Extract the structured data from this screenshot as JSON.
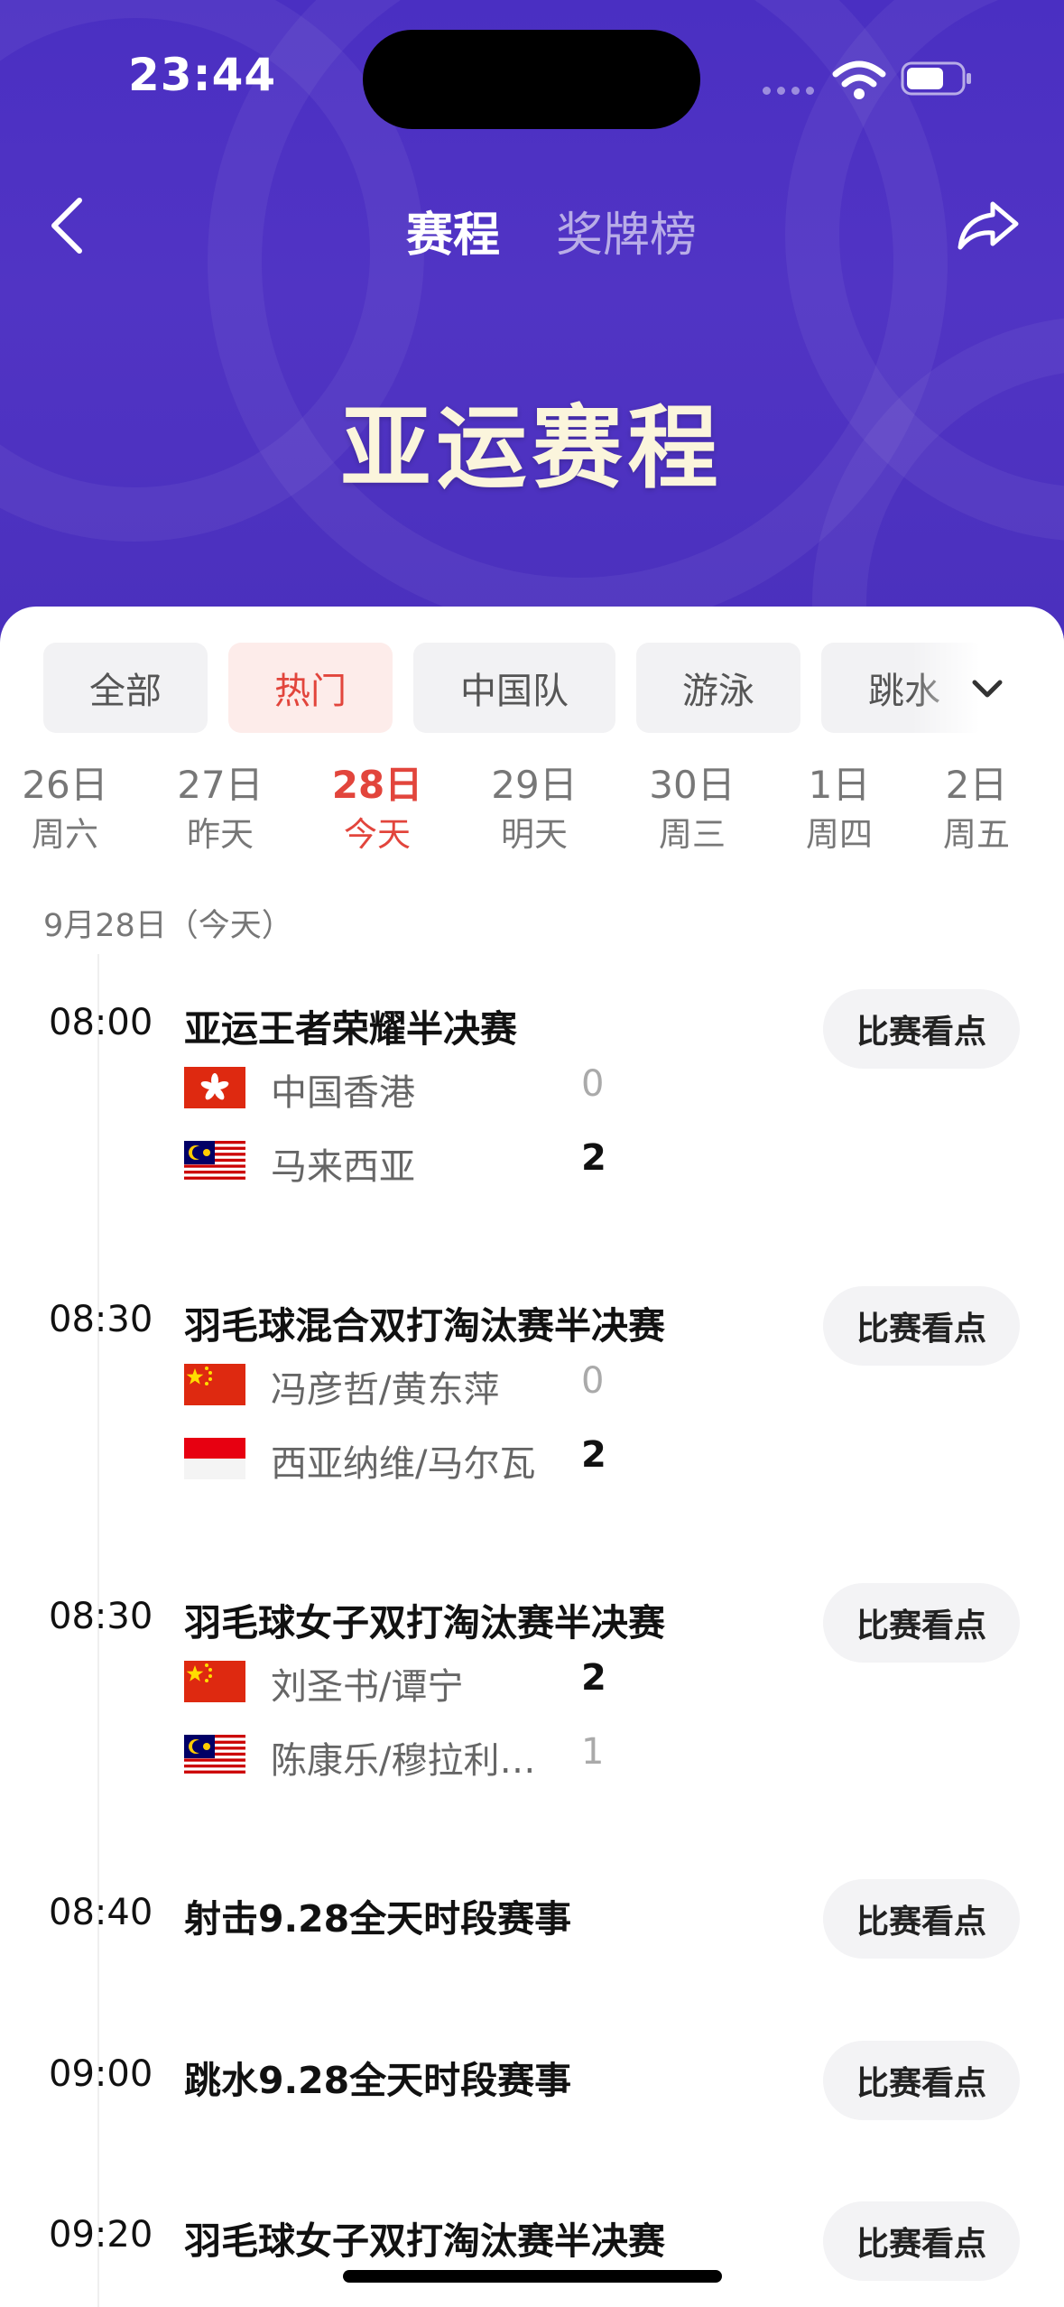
{
  "status": {
    "time": "23:44"
  },
  "nav": {
    "tab_schedule": "赛程",
    "tab_medals": "奖牌榜"
  },
  "hero": {
    "title": "亚运赛程"
  },
  "filters": [
    "全部",
    "热门",
    "中国队",
    "游泳",
    "跳水"
  ],
  "filters_active_index": 1,
  "dates": [
    {
      "day": "26日",
      "week": "周六"
    },
    {
      "day": "27日",
      "week": "昨天"
    },
    {
      "day": "28日",
      "week": "今天"
    },
    {
      "day": "29日",
      "week": "明天"
    },
    {
      "day": "30日",
      "week": "周三"
    },
    {
      "day": "1日",
      "week": "周四"
    },
    {
      "day": "2日",
      "week": "周五"
    }
  ],
  "dates_active_index": 2,
  "section_label": "9月28日（今天）",
  "button_label": "比赛看点",
  "matches": [
    {
      "time": "08:00",
      "title": "亚运王者荣耀半决赛",
      "teams": [
        {
          "flag": "hong-kong-flag",
          "name": "中国香港",
          "score": "0",
          "win": false
        },
        {
          "flag": "malaysia-flag",
          "name": "马来西亚",
          "score": "2",
          "win": true
        }
      ]
    },
    {
      "time": "08:30",
      "title": "羽毛球混合双打淘汰赛半决赛",
      "teams": [
        {
          "flag": "china-flag",
          "name": "冯彦哲/黄东萍",
          "score": "0",
          "win": false
        },
        {
          "flag": "indonesia-flag",
          "name": "西亚纳维/马尔瓦",
          "score": "2",
          "win": true
        }
      ]
    },
    {
      "time": "08:30",
      "title": "羽毛球女子双打淘汰赛半决赛",
      "teams": [
        {
          "flag": "china-flag",
          "name": "刘圣书/谭宁",
          "score": "2",
          "win": true
        },
        {
          "flag": "malaysia-flag",
          "name": "陈康乐/穆拉利…",
          "score": "1",
          "win": false
        }
      ]
    },
    {
      "time": "08:40",
      "title": "射击9.28全天时段赛事",
      "teams": []
    },
    {
      "time": "09:00",
      "title": "跳水9.28全天时段赛事",
      "teams": []
    },
    {
      "time": "09:20",
      "title": "羽毛球女子双打淘汰赛半决赛",
      "teams": []
    }
  ],
  "colors": {
    "header": "#4a2fc2",
    "accent": "#e2453c",
    "title": "#fbf5dc"
  },
  "icons": [
    "back-icon",
    "share-icon",
    "chevron-down-icon",
    "wifi-icon",
    "battery-icon"
  ]
}
